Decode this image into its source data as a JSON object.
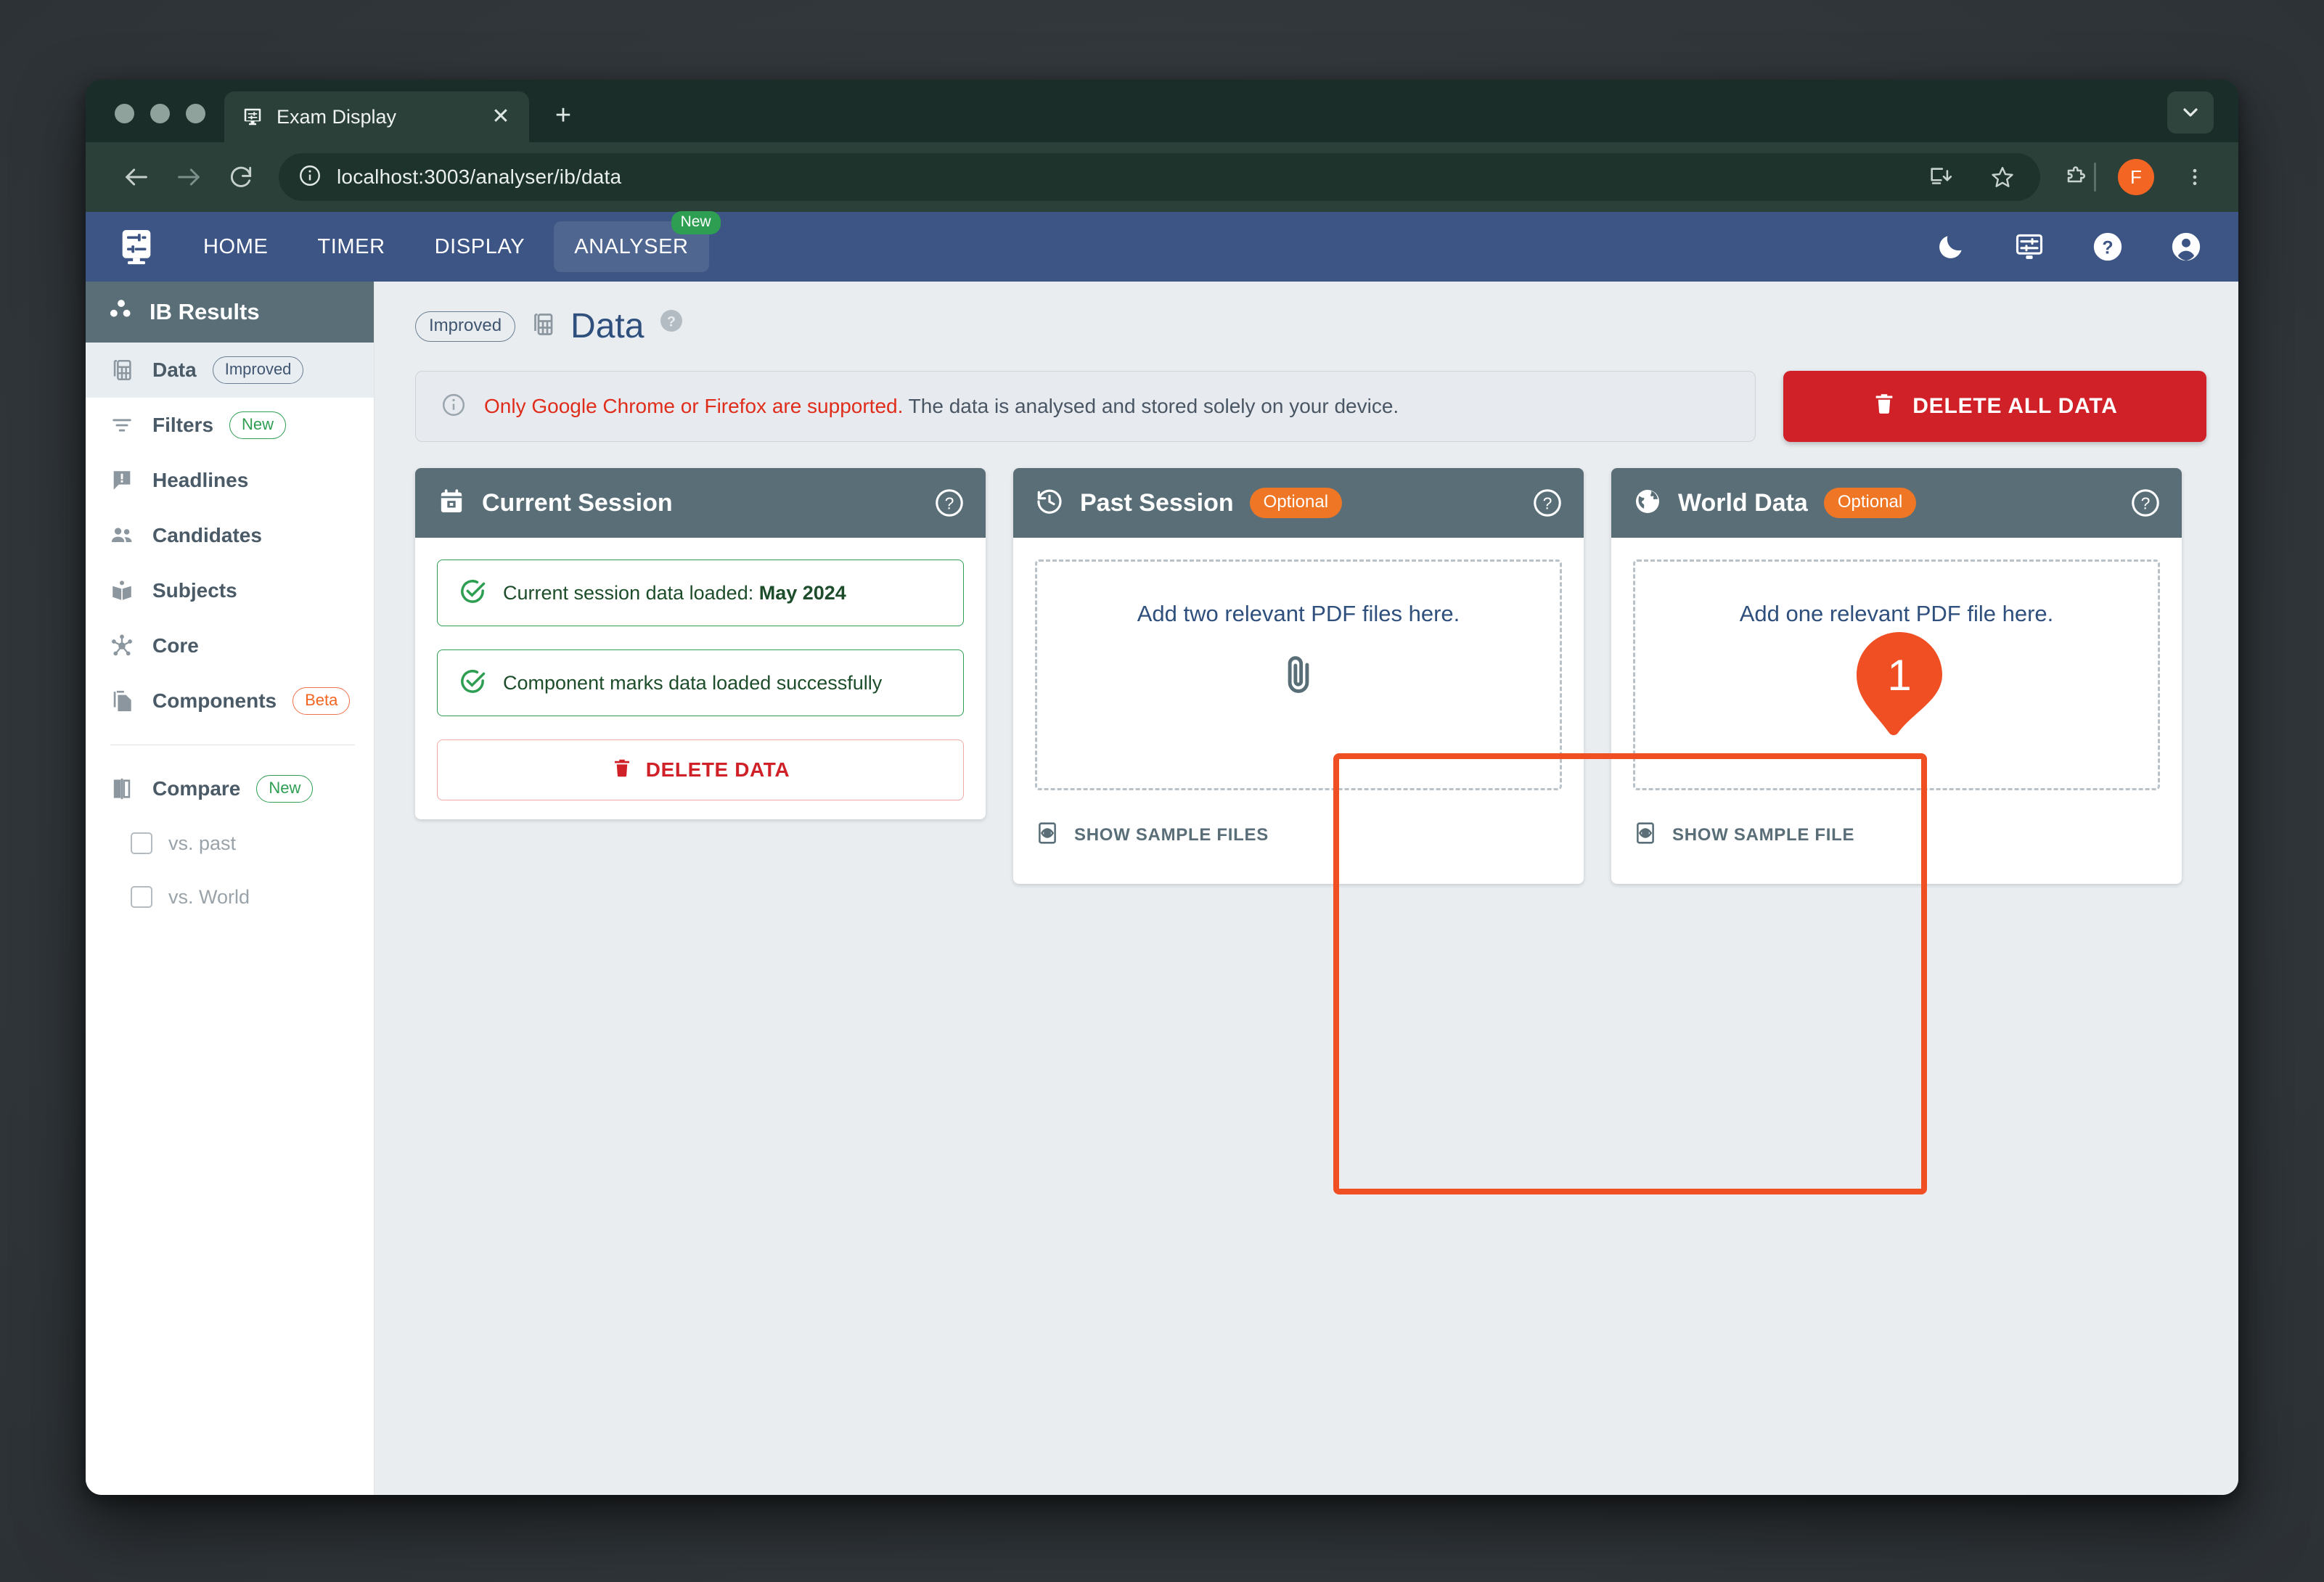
{
  "browser": {
    "tab": {
      "title": "Exam Display",
      "favicon_icon": "display-settings-icon",
      "close_icon": "close-icon"
    },
    "new_tab_label": "+",
    "tab_list_icon": "chevron-down-icon",
    "back_icon": "arrow-left-icon",
    "forward_icon": "arrow-right-icon",
    "reload_icon": "reload-icon",
    "site_info_icon": "info-circle-icon",
    "url": "localhost:3003/analyser/ib/data",
    "install_icon": "install-app-icon",
    "bookmark_icon": "star-icon",
    "extensions_icon": "puzzle-piece-icon",
    "profile_initial": "F",
    "menu_icon": "three-dots-vertical-icon"
  },
  "appbar": {
    "logo_icon": "display-settings-icon",
    "tabs": [
      {
        "label": "HOME",
        "badge": ""
      },
      {
        "label": "TIMER",
        "badge": ""
      },
      {
        "label": "DISPLAY",
        "badge": ""
      },
      {
        "label": "ANALYSER",
        "badge": "New"
      }
    ],
    "icons": [
      {
        "name": "dark-mode-icon"
      },
      {
        "name": "display-settings-icon"
      },
      {
        "name": "help-circle-icon"
      },
      {
        "name": "account-circle-icon"
      }
    ]
  },
  "sidebar": {
    "title": "IB Results",
    "title_icon": "results-dots-icon",
    "items": [
      {
        "label": "Data",
        "badge": "Improved",
        "badge_type": "improved",
        "icon": "data-table-icon",
        "active": true
      },
      {
        "label": "Filters",
        "badge": "New",
        "badge_type": "newp",
        "icon": "filter-icon",
        "active": false
      },
      {
        "label": "Headlines",
        "badge": "",
        "badge_type": "",
        "icon": "announcement-icon",
        "active": false
      },
      {
        "label": "Candidates",
        "badge": "",
        "badge_type": "",
        "icon": "people-icon",
        "active": false
      },
      {
        "label": "Subjects",
        "badge": "",
        "badge_type": "",
        "icon": "book-icon",
        "active": false
      },
      {
        "label": "Core",
        "badge": "",
        "badge_type": "",
        "icon": "hub-icon",
        "active": false
      },
      {
        "label": "Components",
        "badge": "Beta",
        "badge_type": "beta",
        "icon": "copy-docs-icon",
        "active": false
      }
    ],
    "compare": {
      "label": "Compare",
      "badge": "New",
      "icon": "compare-icon",
      "options": [
        {
          "label": "vs. past",
          "checked": false
        },
        {
          "label": "vs. World",
          "checked": false
        }
      ]
    }
  },
  "page": {
    "badge": "Improved",
    "title": "Data",
    "title_icon": "data-table-icon",
    "help_icon": "help-circle-icon"
  },
  "banner": {
    "icon": "info-circle-icon",
    "warning": "Only Google Chrome or Firefox are supported.",
    "text": " The data is analysed and stored solely on your device."
  },
  "delete_all": {
    "label": "DELETE ALL DATA",
    "icon": "trash-icon"
  },
  "marker": {
    "number": "1",
    "color": "#f04e23"
  },
  "cards": [
    {
      "title": "Current Session",
      "icon": "calendar-icon",
      "optional": "",
      "help_icon": "help-circle-icon",
      "statuses": [
        {
          "prefix": "Current session data loaded: ",
          "strong": "May 2024",
          "icon": "check-circle-icon"
        },
        {
          "prefix": "Component marks data loaded successfully",
          "strong": "",
          "icon": "check-circle-icon"
        }
      ],
      "delete_label": "DELETE DATA",
      "delete_icon": "trash-icon"
    },
    {
      "title": "Past Session",
      "icon": "history-icon",
      "optional": "Optional",
      "help_icon": "help-circle-icon",
      "dropzone_text": "Add two relevant PDF files here.",
      "dropzone_icon": "paperclip-icon",
      "sample_label": "SHOW SAMPLE FILES",
      "sample_icon": "preview-icon",
      "highlighted": true
    },
    {
      "title": "World Data",
      "icon": "globe-icon",
      "optional": "Optional",
      "help_icon": "help-circle-icon",
      "dropzone_text": "Add one relevant PDF file here.",
      "dropzone_icon": "paperclip-icon",
      "sample_label": "SHOW SAMPLE FILE",
      "sample_icon": "preview-icon",
      "highlighted": false
    }
  ],
  "colors": {
    "appbar": "#3c5584",
    "card_header": "#5a6e78",
    "accent_orange": "#f04e23",
    "optional_badge": "#ef7625",
    "danger": "#cf2127",
    "success": "#2e9e52",
    "page_bg": "#e9edf0"
  }
}
